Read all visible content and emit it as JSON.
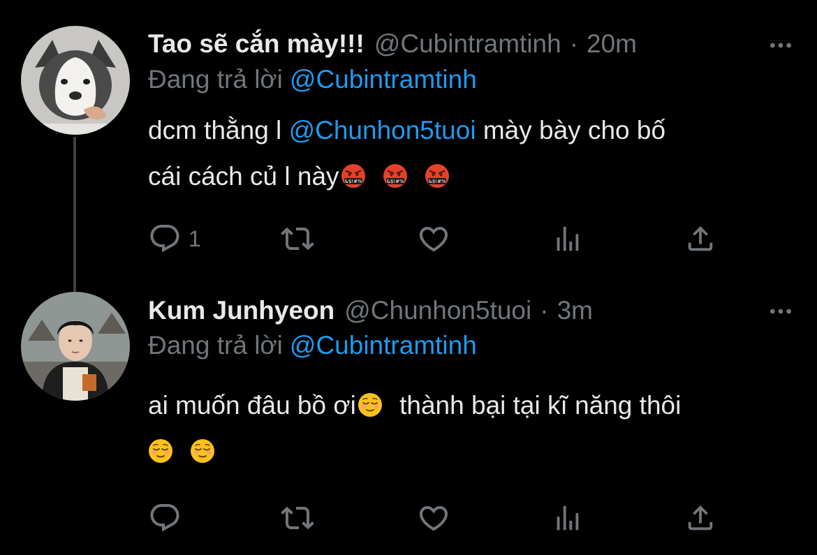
{
  "tweets": [
    {
      "name": "Tao sẽ cắn mày!!!",
      "handle": "@Cubintramtinh",
      "separator": "·",
      "time": "20m",
      "reply_prefix": "Đang trả lời",
      "reply_to": "@Cubintramtinh",
      "body_line1_before": "dcm thằng l",
      "body_line1_mention": "@Chunhon5tuoi",
      "body_line1_after": "mày bày cho bố",
      "body_line2": "cái cách củ l này",
      "body_emojis": [
        "angry-swearing-emoji",
        "angry-swearing-emoji",
        "angry-swearing-emoji"
      ],
      "reply_count": "1",
      "avatar": "husky-dog-avatar"
    },
    {
      "name": "Kum Junhyeon",
      "handle": "@Chunhon5tuoi",
      "separator": "·",
      "time": "3m",
      "reply_prefix": "Đang trả lời",
      "reply_to": "@Cubintramtinh",
      "body_line1_a": "ai muốn đâu bồ ơi",
      "body_line1_b": "thành bại tại kĩ năng thôi",
      "body_emojis": [
        "relieved-face-emoji",
        "relieved-face-emoji",
        "relieved-face-emoji"
      ],
      "reply_count": "",
      "avatar": "young-man-varsity-jacket-avatar"
    }
  ],
  "colors": {
    "background": "#000000",
    "text_primary": "#e7e9ea",
    "text_secondary": "#71767b",
    "accent": "#1d9bf0",
    "thread_line": "#3e4144"
  },
  "icons": [
    "reply-icon",
    "retweet-icon",
    "like-icon",
    "analytics-icon",
    "share-icon",
    "more-icon"
  ]
}
